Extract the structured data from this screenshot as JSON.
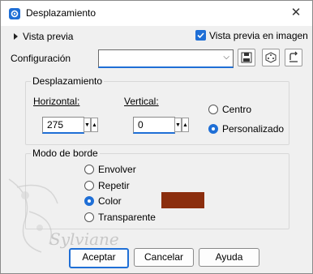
{
  "window": {
    "title": "Desplazamiento",
    "close_glyph": "✕"
  },
  "preview": {
    "toggle_label": "Vista previa",
    "checkbox_label": "Vista previa en imagen",
    "checked": true
  },
  "config": {
    "label": "Configuración",
    "value": ""
  },
  "offset_group": {
    "title": "Desplazamiento",
    "horizontal_label": "Horizontal:",
    "horizontal_value": "275",
    "vertical_label": "Vertical:",
    "vertical_value": "0",
    "radio_center": "Centro",
    "radio_custom": "Personalizado",
    "selected": "Personalizado"
  },
  "border_group": {
    "title": "Modo de borde",
    "options": [
      "Envolver",
      "Repetir",
      "Color",
      "Transparente"
    ],
    "selected": "Color",
    "color": "#8b2e0e"
  },
  "watermark": "Sylviane",
  "buttons": {
    "ok": "Aceptar",
    "cancel": "Cancelar",
    "help": "Ayuda"
  },
  "colors": {
    "accent": "#1f6fd6",
    "background": "#f0f0f0"
  }
}
